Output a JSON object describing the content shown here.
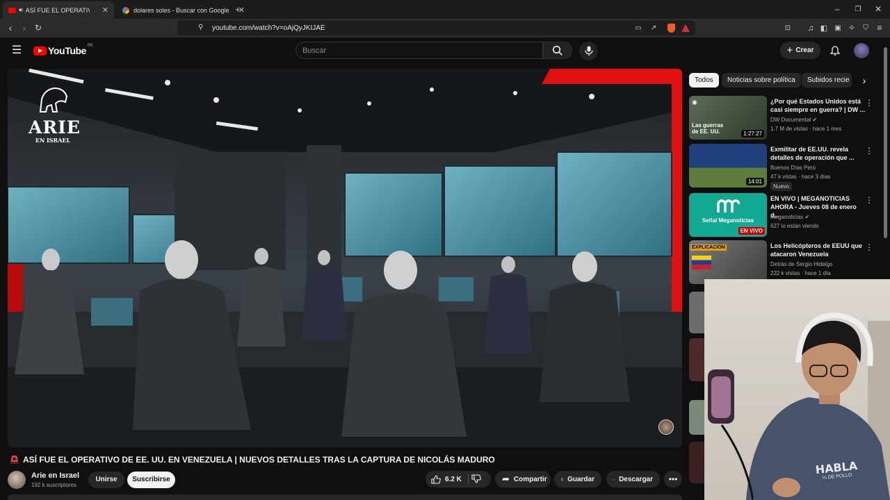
{
  "browser": {
    "tabs": [
      {
        "title": "ASÍ FUE EL OPERATIVO DE EE. UU.",
        "active": true
      },
      {
        "title": "dolares soles - Buscar con Google",
        "active": false
      }
    ],
    "url": "youtube.com/watch?v=oAjQyJKIJAE"
  },
  "youtube": {
    "logo_text": "YouTube",
    "region": "PE",
    "search_placeholder": "Buscar",
    "create_label": "Crear"
  },
  "video": {
    "title": "ASÍ FUE EL OPERATIVO DE EE. UU. EN VENEZUELA | NUEVOS DETALLES TRAS LA CAPTURA DE NICOLÁS MADURO",
    "overlay_logo_line1": "ARIE",
    "overlay_logo_line2": "EN ISRAEL",
    "channel_name": "Arie en Israel",
    "subscribers": "192 k suscriptores",
    "join_label": "Unirse",
    "subscribe_label": "Suscribirse",
    "likes": "6.2 K",
    "share_label": "Compartir",
    "save_label": "Guardar",
    "download_label": "Descargar"
  },
  "chips": [
    "Todos",
    "Noticias sobre política",
    "Subidos recie"
  ],
  "recommendations": [
    {
      "title": "¿Por qué Estados Unidos está casi siempre en guerra? | DW ...",
      "channel": "DW Documental",
      "meta": "1.7 M de vistas · hace 1 mes",
      "duration": "1:27:27",
      "thumb_text": "Las guerras de EE. UU.",
      "thumb_color": "#3d4a3a"
    },
    {
      "title": "Exmilitar de EE.UU. revela detalles de operación que ...",
      "channel": "Buenos Días Perú",
      "meta": "47 k vistas · hace 3 días",
      "duration": "14:01",
      "badge": "Nuevo",
      "thumb_color": "#2a4a80"
    },
    {
      "title": "EN VIVO | MEGANOTICIAS AHORA - Jueves 08 de enero d...",
      "channel": "Meganoticias",
      "meta": "627 lo están viendo",
      "live": "EN VIVO",
      "thumb_text": "Señal Meganoticias",
      "thumb_color": "#13a893"
    },
    {
      "title": "Los Helicópteros de EEUU que atacaron Venezuela",
      "channel": "Detrás de Sergio Hidalgo",
      "meta": "222 k vistas · hace 1 día",
      "thumb_text": "EXPLICACIÓN",
      "thumb_color": "#5a5a5a"
    }
  ],
  "webcam": {
    "shirt_text_1": "HABLA",
    "shirt_text_2": "¼ DE POLLO"
  }
}
